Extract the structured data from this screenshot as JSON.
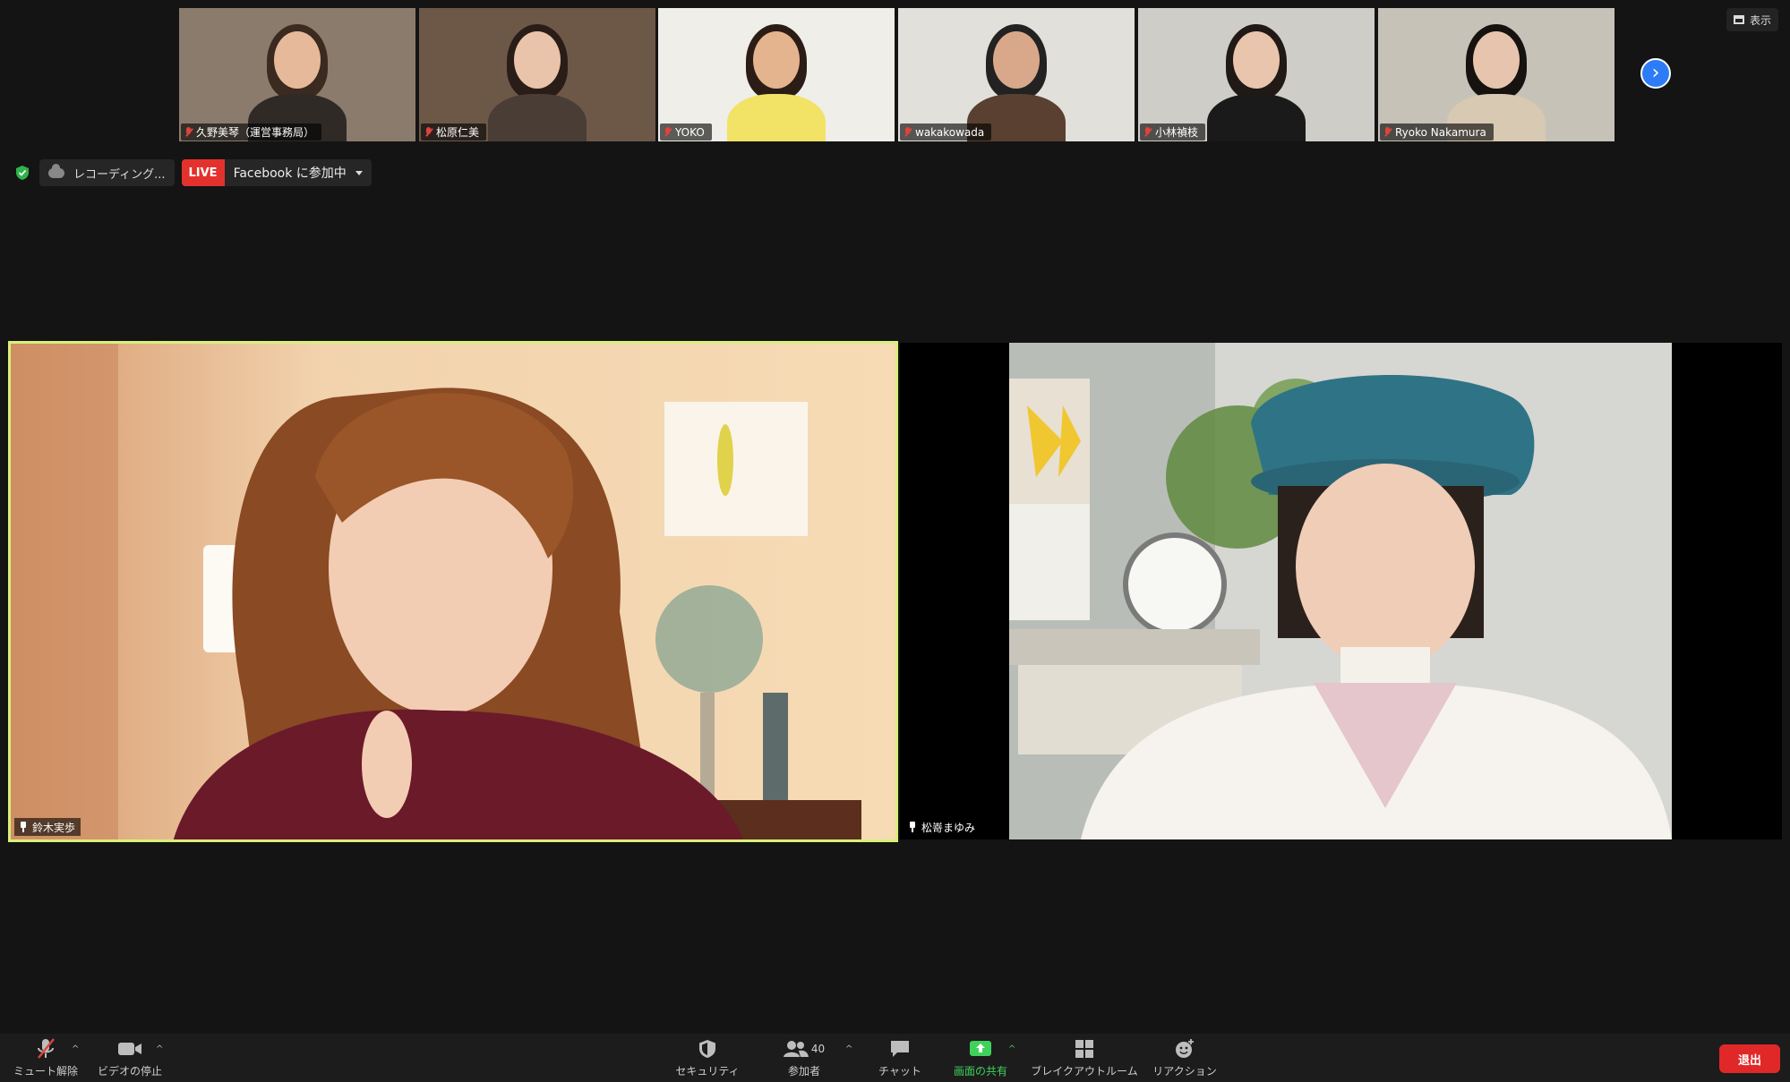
{
  "thumbnails": [
    {
      "name": "久野美琴（運営事務局）",
      "bg": "#8a7b6c",
      "skin": "#e6b99a",
      "hair": "#3a2a20",
      "shirt": "#2f2a26"
    },
    {
      "name": "松原仁美",
      "bg": "#6d5848",
      "skin": "#e9c4aa",
      "hair": "#2a1d18",
      "shirt": "#4a3d36"
    },
    {
      "name": "YOKO",
      "bg": "#efeee8",
      "skin": "#e4b48f",
      "hair": "#2b1d15",
      "shirt": "#f2e266"
    },
    {
      "name": "wakakowada",
      "bg": "#e2e0db",
      "skin": "#d9a88a",
      "hair": "#222",
      "shirt": "#5a4030"
    },
    {
      "name": "小林禎枝",
      "bg": "#cfcdc8",
      "skin": "#e8c5ac",
      "hair": "#201915",
      "shirt": "#1a1a1a"
    },
    {
      "name": "Ryoko Nakamura",
      "bg": "#c6c2b8",
      "skin": "#e7c4ad",
      "hair": "#151210",
      "shirt": "#d8c9b3"
    }
  ],
  "view_button": {
    "label": "表示",
    "icon": "grid-icon"
  },
  "status": {
    "recording_label": "レコーディング...",
    "live_tag": "LIVE",
    "live_text": "Facebook に参加中"
  },
  "videos": {
    "left": {
      "name": "鈴木実歩"
    },
    "right": {
      "name": "松嵜まゆみ"
    }
  },
  "toolbar": {
    "mute_label": "ミュート解除",
    "video_label": "ビデオの停止",
    "security_label": "セキュリティ",
    "participants_label": "参加者",
    "participants_count": "40",
    "chat_label": "チャット",
    "share_label": "画面の共有",
    "breakout_label": "ブレイクアウトルーム",
    "reaction_label": "リアクション",
    "leave_label": "退出"
  },
  "colors": {
    "active_speaker_border": "#d9f07a",
    "live_red": "#e3322d",
    "share_green": "#3fd25b",
    "leave_red": "#e02828",
    "next_blue": "#2d7cf6"
  }
}
